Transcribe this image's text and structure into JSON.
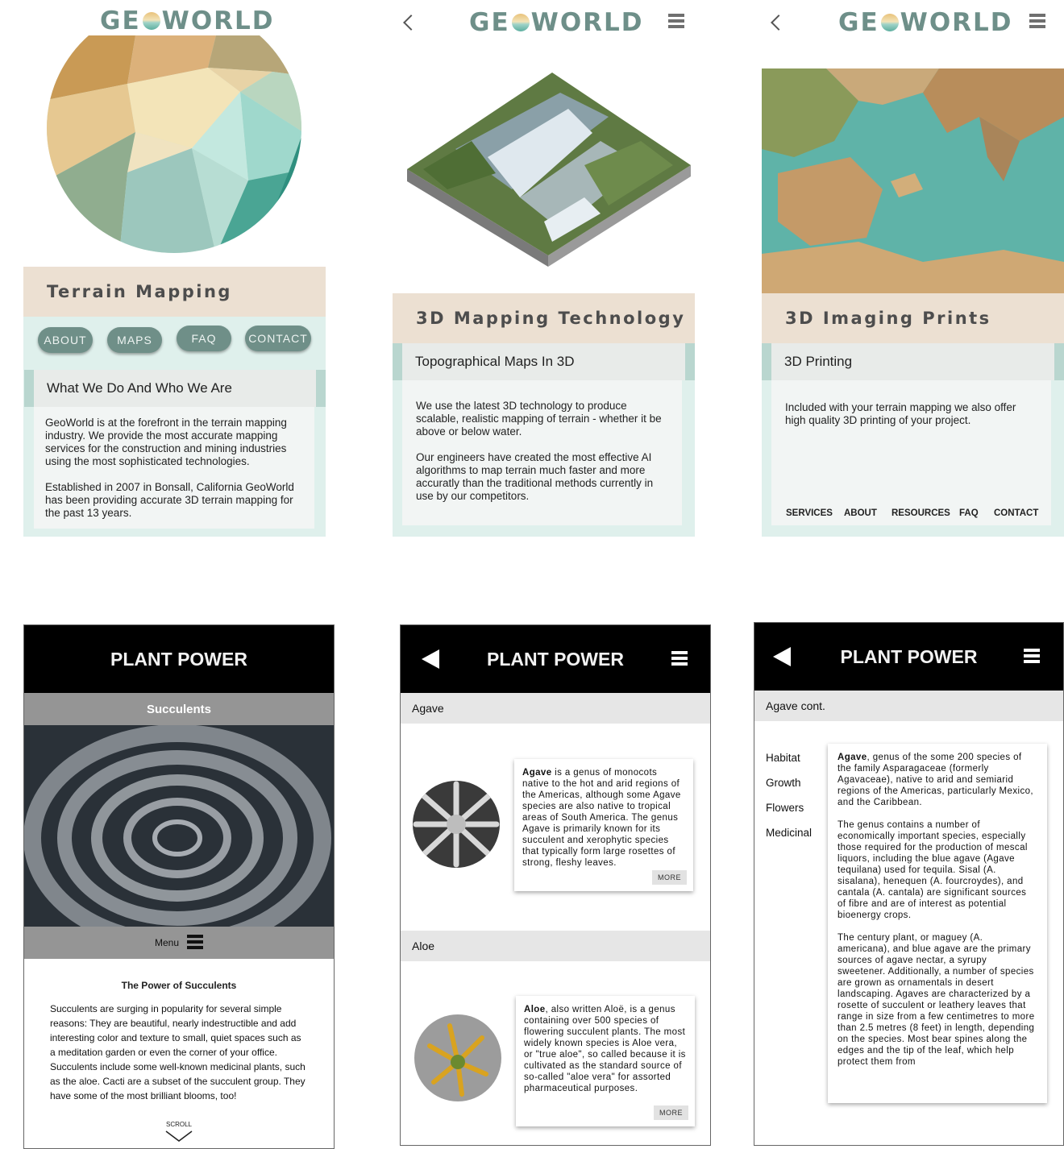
{
  "brand": {
    "geo_logo_left": "GE",
    "geo_logo_right": "WORLD",
    "plant_title": "PLANT POWER"
  },
  "screen1": {
    "heading": "Terrain Mapping",
    "pills": [
      "ABOUT",
      "MAPS",
      "FAQ",
      "CONTACT"
    ],
    "subheading": "What We Do And Who We Are",
    "paragraphs": [
      "GeoWorld is at the forefront in the terrain mapping industry. We provide the most accurate mapping services for the construction and mining industries using the most sophisticated technologies.",
      "Established in 2007 in Bonsall, California GeoWorld has been providing accurate 3D terrain mapping for the past 13 years."
    ]
  },
  "screen2": {
    "heading": "3D Mapping Technology",
    "subheading": "Topographical Maps In 3D",
    "paragraphs": [
      "We use the latest 3D technology to produce scalable, realistic mapping of terrain - whether it be above or below water.",
      "Our engineers have created the most effective AI algorithms to map terrain much faster and more accuratly than the traditional methods currently in use by our competitors."
    ]
  },
  "screen3": {
    "heading": "3D Imaging Prints",
    "subheading": "3D Printing",
    "paragraph": "Included with your terrain mapping we also offer high quality 3D printing of your project.",
    "nav": [
      "SERVICES",
      "ABOUT",
      "RESOURCES",
      "FAQ",
      "CONTACT"
    ]
  },
  "screen4": {
    "section": "Succulents",
    "menu_label": "Menu",
    "article_title": "The Power of Succulents",
    "article_text": "Succulents are surging in popularity for several simple reasons: They are beautiful, nearly indestructible and add interesting color and texture to small, quiet spaces such as a meditation garden or even the corner of your office. Succulents include some well-known medicinal plants, such as the aloe. Cacti are a subset of the succulent group. They have some of the most brilliant blooms, too!",
    "scroll_label": "SCROLL"
  },
  "screen5": {
    "agave_label": "Agave",
    "agave_bold": "Agave",
    "agave_text": " is a genus of monocots native to the hot and arid regions of the Americas, although some Agave species are also native to tropical areas of South America. The genus Agave is primarily known for its succulent and xerophytic species that typically form large rosettes of strong, fleshy leaves.",
    "aloe_label": "Aloe",
    "aloe_bold": "Aloe",
    "aloe_text": ", also written Aloë, is a genus containing over 500 species of flowering succulent plants. The most widely known species is Aloe vera, or \"true aloe\", so called because it is cultivated as the standard source of so-called \"aloe vera\" for assorted pharmaceutical purposes.",
    "more_label": "MORE"
  },
  "screen6": {
    "section": "Agave cont.",
    "side_links": [
      "Habitat",
      "Growth",
      "Flowers",
      "Medicinal"
    ],
    "lead_bold": "Agave",
    "lead_text": ", genus of the some 200 species of the family Asparagaceae (formerly Agavaceae), native to arid and semiarid regions of the Americas, particularly Mexico, and the Caribbean.",
    "para2": "The genus contains a number of economically important species, especially those required for the production of mescal liquors, including the blue agave (Agave tequilana) used for tequila. Sisal (A. sisalana), henequen (A. fourcroydes), and cantala (A. cantala) are significant sources of fibre and are of interest as potential bioenergy crops.",
    "para3": "The century plant, or maguey (A. americana), and blue agave are the primary sources of agave nectar, a syrupy sweetener. Additionally, a number of species are grown as ornamentals in desert landscaping. Agaves are characterized by a rosette of succulent or leathery leaves that range in size from a few centimetres to more than 2.5 metres (8 feet) in length, depending on the species. Most bear spines along the edges and the tip of the leaf, which help protect them from"
  },
  "colors": {
    "geo_accent": "#6e8f89",
    "geo_card": "#dff0ec",
    "geo_beige": "#ece0d2",
    "plant_header": "#000000"
  }
}
